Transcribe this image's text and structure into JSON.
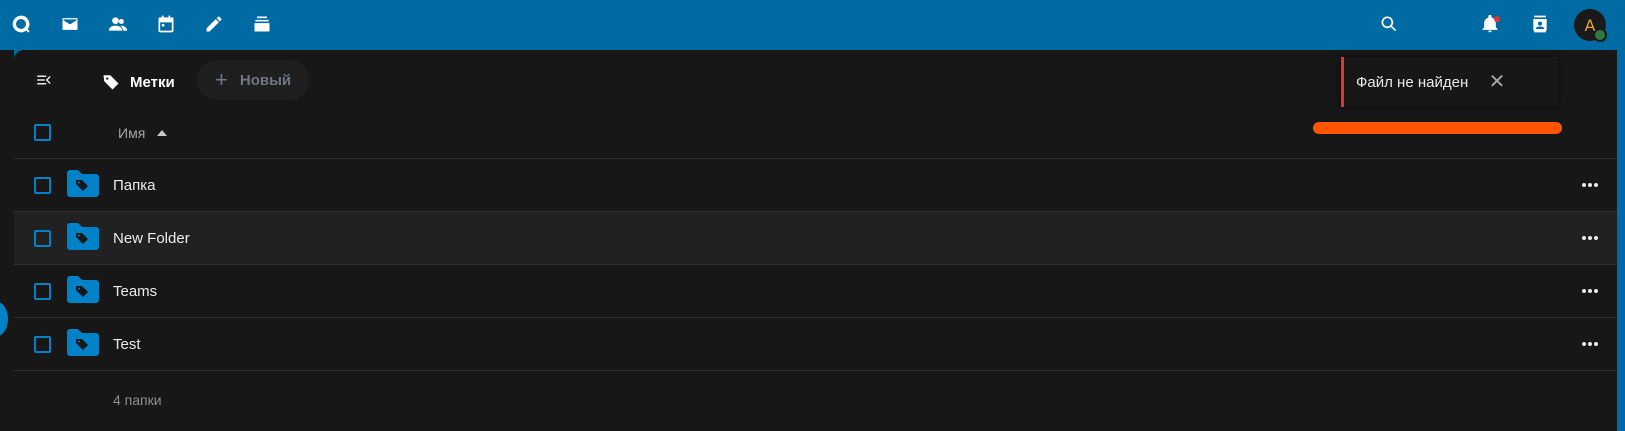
{
  "header": {
    "apps": [
      {
        "name": "dashboard-icon"
      },
      {
        "name": "mail-icon"
      },
      {
        "name": "contacts-icon"
      },
      {
        "name": "calendar-icon"
      },
      {
        "name": "notes-icon"
      },
      {
        "name": "files-icon"
      }
    ],
    "right_icons": [
      "search-icon",
      "bell-icon",
      "contacts-menu-icon"
    ],
    "avatar_initial": "A"
  },
  "breadcrumb": {
    "label": "Метки"
  },
  "new_button": {
    "label": "Новый"
  },
  "table": {
    "column_name": "Имя",
    "rows": [
      {
        "name": "Папка"
      },
      {
        "name": "New Folder"
      },
      {
        "name": "Teams"
      },
      {
        "name": "Test"
      }
    ],
    "summary": "4 папки"
  },
  "toast": {
    "message": "Файл не найден",
    "close": "✕"
  },
  "colors": {
    "accent": "#0082c9",
    "header": "#006aa3",
    "progress": "#ff5500",
    "toast_border": "#e9322d"
  }
}
